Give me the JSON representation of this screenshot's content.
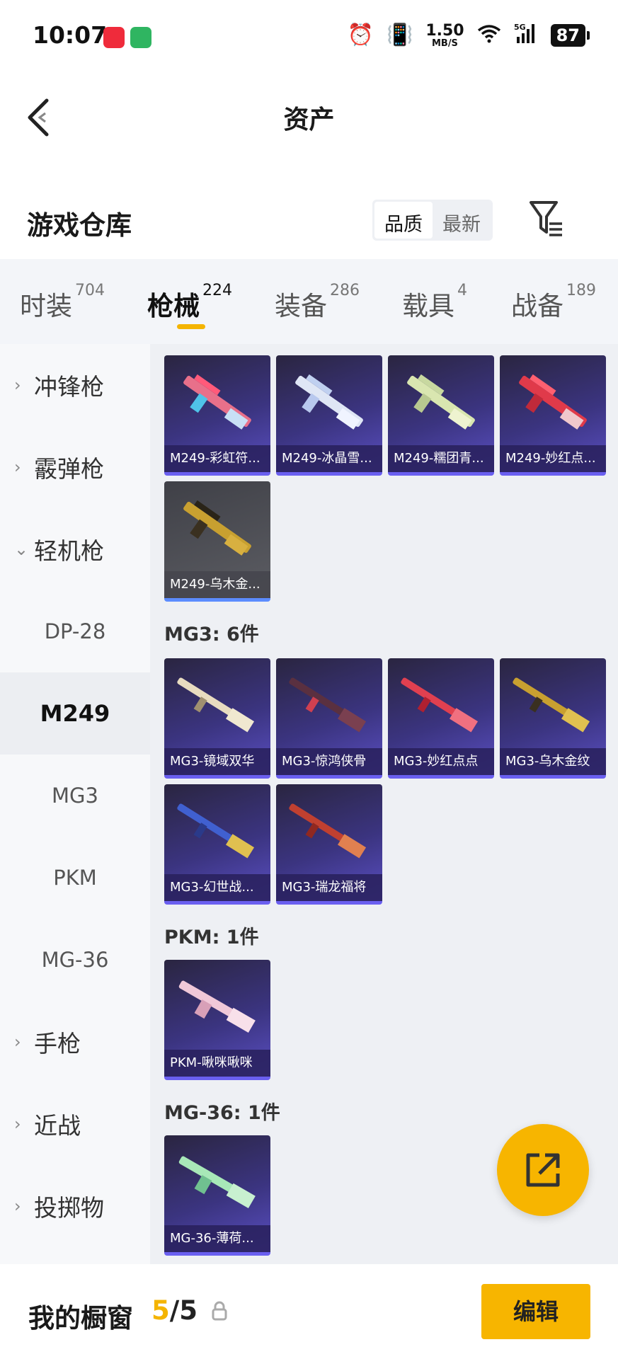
{
  "status_bar": {
    "time": "10:07",
    "net_speed_value": "1.50",
    "net_speed_unit": "MB/S",
    "signal": "5G",
    "battery": "87",
    "icons": [
      "alarm-icon",
      "vibrate-icon",
      "wifi-icon",
      "signal-icon"
    ]
  },
  "nav": {
    "title": "资产"
  },
  "warehouse": {
    "title": "游戏仓库",
    "sort_options": [
      "品质",
      "最新"
    ],
    "selected_sort": "品质"
  },
  "tabs": [
    {
      "label": "时装",
      "count": "704"
    },
    {
      "label": "枪械",
      "count": "224"
    },
    {
      "label": "装备",
      "count": "286"
    },
    {
      "label": "载具",
      "count": "4"
    },
    {
      "label": "战备",
      "count": "189"
    }
  ],
  "active_tab": "枪械",
  "sidebar": {
    "categories": [
      "冲锋枪",
      "霰弹枪",
      "轻机枪",
      "手枪",
      "近战",
      "投掷物"
    ],
    "subcategories": [
      "DP-28",
      "M249",
      "MG3",
      "PKM",
      "MG-36"
    ],
    "active_sub": "M249"
  },
  "groups": [
    {
      "header": "",
      "items": [
        "M249-彩虹符...",
        "M249-冰晶雪...",
        "M249-糯团青...",
        "M249-妙红点...",
        "M249-乌木金..."
      ]
    },
    {
      "header": "MG3: 6件",
      "items": [
        "MG3-镜域双华",
        "MG3-惊鸿侠骨",
        "MG3-妙红点点",
        "MG3-乌木金纹",
        "MG3-幻世战...",
        "MG3-瑞龙福将"
      ]
    },
    {
      "header": "PKM: 1件",
      "items": [
        "PKM-啾咪啾咪"
      ]
    },
    {
      "header": "MG-36: 1件",
      "items": [
        "MG-36-薄荷..."
      ]
    }
  ],
  "bottom": {
    "showcase_label": "我的橱窗",
    "current": "5",
    "total": "5",
    "edit_label": "编辑"
  },
  "colors": {
    "accent": "#f7b500",
    "card_purple": "#3b3480"
  }
}
